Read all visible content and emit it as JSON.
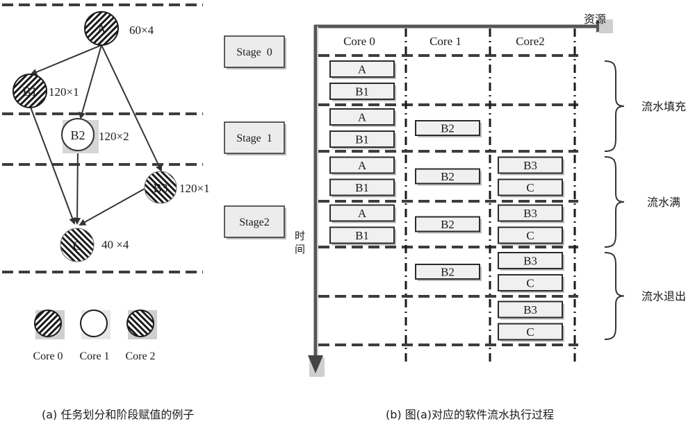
{
  "panel_a": {
    "caption": "(a) 任务划分和阶段赋值的例子",
    "nodes": [
      {
        "id": "A",
        "label": "A",
        "size": "60×4",
        "core": "core0"
      },
      {
        "id": "B1",
        "label": "B1",
        "size": "120×1",
        "core": "core0"
      },
      {
        "id": "B2",
        "label": "B2",
        "size": "120×2",
        "core": "core1"
      },
      {
        "id": "B3",
        "label": "B3",
        "size": "120×1",
        "core": "core2"
      },
      {
        "id": "C",
        "label": "C",
        "size": "40 ×4",
        "core": "core2"
      }
    ],
    "edges": [
      {
        "from": "A",
        "to": "B1"
      },
      {
        "from": "A",
        "to": "B2"
      },
      {
        "from": "A",
        "to": "B3"
      },
      {
        "from": "B1",
        "to": "C"
      },
      {
        "from": "B2",
        "to": "C"
      },
      {
        "from": "B3",
        "to": "C"
      }
    ],
    "legend": [
      {
        "label": "Core 0",
        "pattern": "hatch-dense"
      },
      {
        "label": "Core 1",
        "pattern": "empty"
      },
      {
        "label": "Core 2",
        "pattern": "hatch-reverse"
      }
    ]
  },
  "stages": [
    "Stage  0",
    "Stage  1",
    "Stage2"
  ],
  "panel_b": {
    "caption": "(b) 图(a)对应的软件流水执行过程",
    "x_axis_label": "资源",
    "y_axis_label": "时间",
    "columns": [
      "Core 0",
      "Core 1",
      "Core2"
    ],
    "rows": [
      {
        "core0": [
          "A",
          "B1"
        ],
        "core1": [],
        "core2": []
      },
      {
        "core0": [
          "A",
          "B1"
        ],
        "core1": [
          "B2"
        ],
        "core2": []
      },
      {
        "core0": [
          "A",
          "B1"
        ],
        "core1": [
          "B2"
        ],
        "core2": [
          "B3",
          "C"
        ]
      },
      {
        "core0": [
          "A",
          "B1"
        ],
        "core1": [
          "B2"
        ],
        "core2": [
          "B3",
          "C"
        ]
      },
      {
        "core0": [],
        "core1": [
          "B2"
        ],
        "core2": [
          "B3",
          "C"
        ]
      },
      {
        "core0": [],
        "core1": [],
        "core2": [
          "B3",
          "C"
        ]
      }
    ],
    "phases": [
      {
        "label": "流水填充",
        "rows": [
          0,
          1
        ]
      },
      {
        "label": "流水满",
        "rows": [
          2,
          3
        ]
      },
      {
        "label": "流水退出",
        "rows": [
          4,
          5
        ]
      }
    ]
  },
  "colors": {
    "line": "#3d3d3d",
    "box_fill": "#f0f0f0",
    "shadow": "#bdbdbd",
    "axis": "#555555"
  }
}
